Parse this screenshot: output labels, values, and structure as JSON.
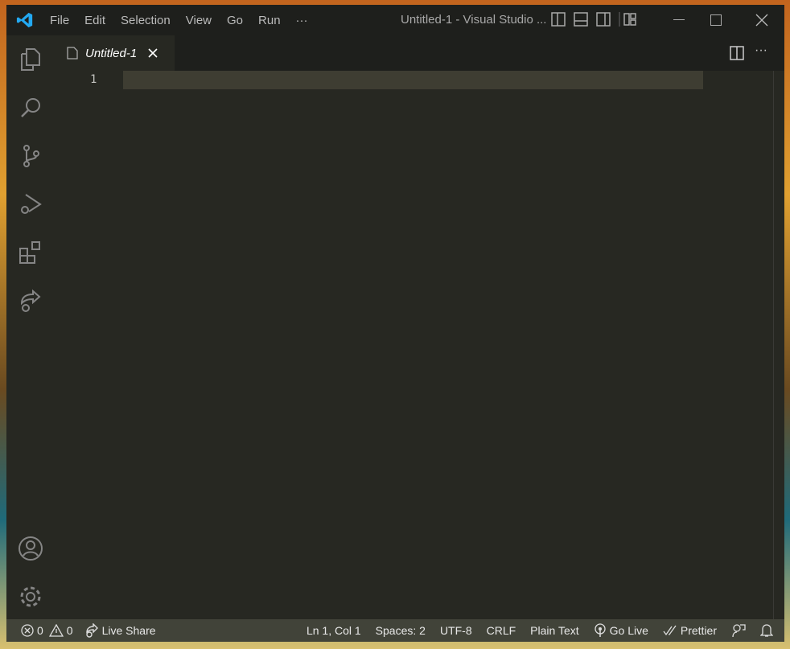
{
  "menu": [
    "File",
    "Edit",
    "Selection",
    "View",
    "Go",
    "Run",
    "···"
  ],
  "window_title": "Untitled-1 - Visual Studio ...",
  "tab": {
    "label": "Untitled-1"
  },
  "editor": {
    "line_numbers": [
      "1"
    ]
  },
  "status": {
    "errors": "0",
    "warnings": "0",
    "live_share": "Live Share",
    "position": "Ln 1, Col 1",
    "spaces": "Spaces: 2",
    "encoding": "UTF-8",
    "eol": "CRLF",
    "language": "Plain Text",
    "go_live": "Go Live",
    "prettier": "Prettier"
  },
  "colors": {
    "accent": "#23a9f2",
    "editor_bg": "#272822",
    "current_line": "#3e3d32",
    "status_bg": "#414339"
  }
}
